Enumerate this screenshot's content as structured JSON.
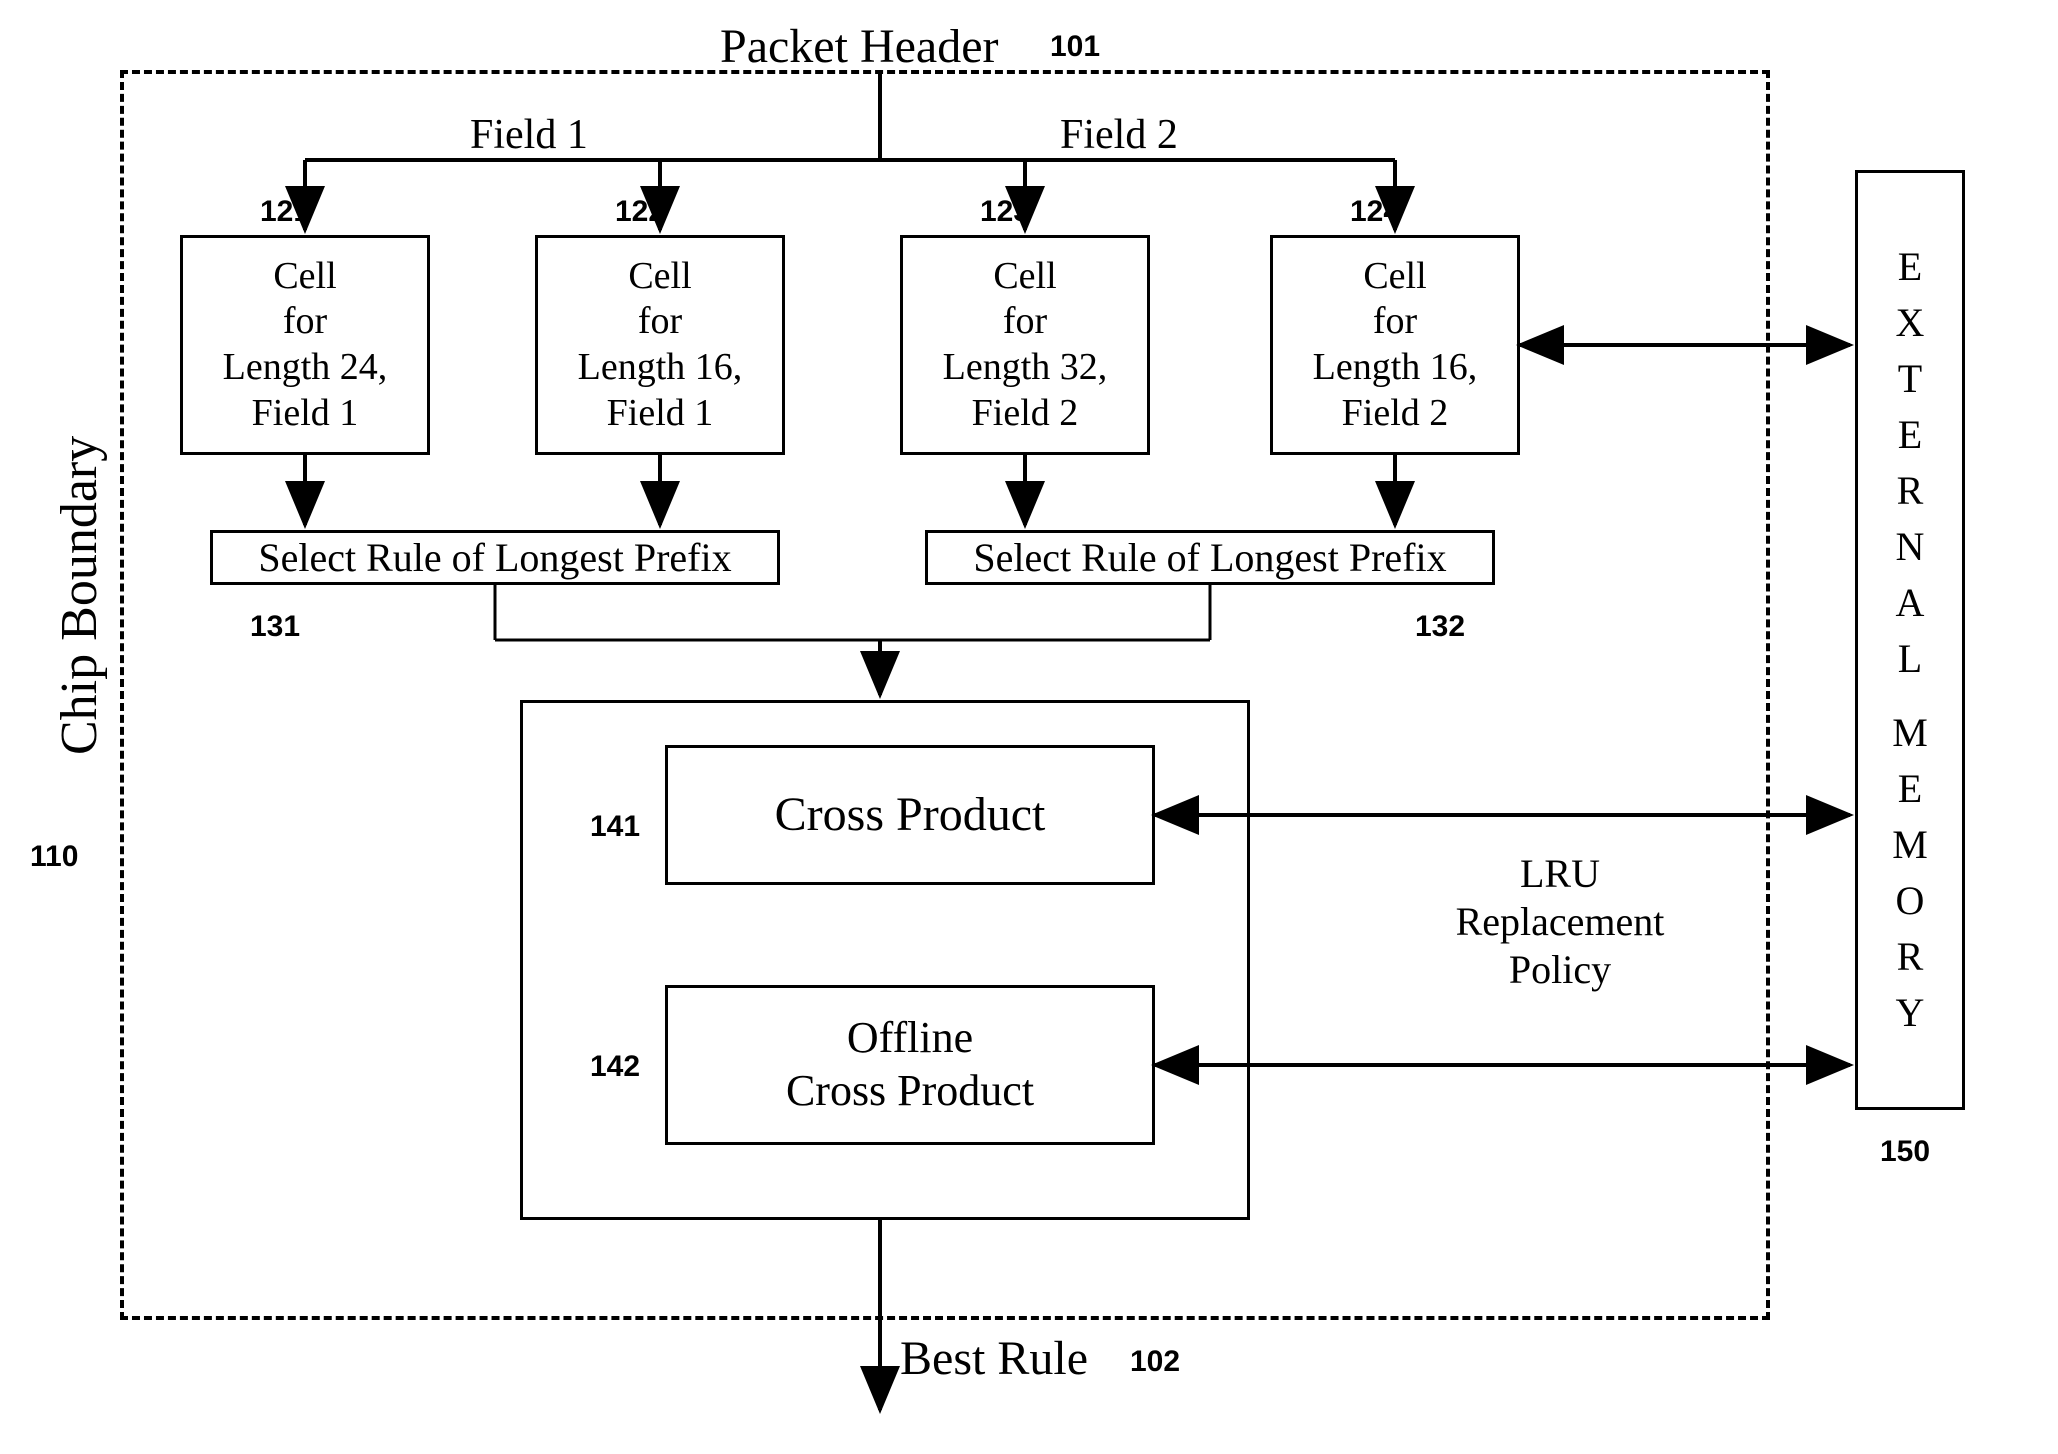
{
  "top": {
    "title": "Packet Header",
    "title_num": "101",
    "field1": "Field 1",
    "field2": "Field 2"
  },
  "cells": {
    "c121": {
      "num": "121",
      "text": "Cell\nfor\nLength 24,\nField 1"
    },
    "c122": {
      "num": "122",
      "text": "Cell\nfor\nLength 16,\nField 1"
    },
    "c123": {
      "num": "123",
      "text": "Cell\nfor\nLength 32,\nField 2"
    },
    "c124": {
      "num": "124",
      "text": "Cell\nfor\nLength 16,\nField 2"
    }
  },
  "select": {
    "s131": {
      "num": "131",
      "text": "Select Rule of Longest Prefix"
    },
    "s132": {
      "num": "132",
      "text": "Select Rule of Longest Prefix"
    }
  },
  "cross": {
    "c141": {
      "num": "141",
      "text": "Cross Product"
    },
    "c142": {
      "num": "142",
      "text": "Offline\nCross Product"
    }
  },
  "side": {
    "chip": "Chip Boundary",
    "chip_num": "110",
    "lru": "LRU\nReplacement\nPolicy",
    "ext_mem": "EXTERNAL MEMORY",
    "ext_num": "150"
  },
  "bottom": {
    "best": "Best Rule",
    "best_num": "102"
  }
}
